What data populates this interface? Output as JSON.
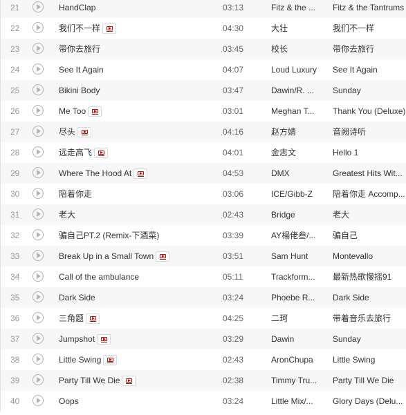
{
  "colors": {
    "row_alt": "#f7f7f7",
    "mv_icon": "#c20c0c",
    "play_icon": "#b3b3b3"
  },
  "tracks": [
    {
      "no": "21",
      "title": "HandClap",
      "mv": false,
      "duration": "03:13",
      "artist": "Fitz & the ...",
      "album": "Fitz & the Tantrums"
    },
    {
      "no": "22",
      "title": "我们不一样",
      "mv": true,
      "duration": "04:30",
      "artist": "大壮",
      "album": "我们不一样"
    },
    {
      "no": "23",
      "title": "带你去旅行",
      "mv": false,
      "duration": "03:45",
      "artist": "校长",
      "album": "带你去旅行"
    },
    {
      "no": "24",
      "title": "See It Again",
      "mv": false,
      "duration": "04:07",
      "artist": "Loud Luxury",
      "album": "See It Again"
    },
    {
      "no": "25",
      "title": "Bikini Body",
      "mv": false,
      "duration": "03:47",
      "artist": "Dawin/R. ...",
      "album": "Sunday"
    },
    {
      "no": "26",
      "title": "Me Too",
      "mv": true,
      "duration": "03:01",
      "artist": "Meghan T...",
      "album": "Thank You (Deluxe)"
    },
    {
      "no": "27",
      "title": "尽头",
      "mv": true,
      "duration": "04:16",
      "artist": "赵方婧",
      "album": "音阙诗听"
    },
    {
      "no": "28",
      "title": "远走高飞",
      "mv": true,
      "duration": "04:01",
      "artist": "金志文",
      "album": "Hello 1"
    },
    {
      "no": "29",
      "title": "Where The Hood At",
      "mv": true,
      "duration": "04:53",
      "artist": "DMX",
      "album": "Greatest Hits Wit..."
    },
    {
      "no": "30",
      "title": "陪着你走",
      "mv": false,
      "duration": "03:06",
      "artist": "ICE/Gibb-Z",
      "album": "陪着你走 Accomp..."
    },
    {
      "no": "31",
      "title": "老大",
      "mv": false,
      "duration": "02:43",
      "artist": "Bridge",
      "album": "老大"
    },
    {
      "no": "32",
      "title": "骗自己PT.2 (Remix-下酒菜)",
      "mv": false,
      "duration": "03:39",
      "artist": "AY楊佬叁/...",
      "album": "骗自己"
    },
    {
      "no": "33",
      "title": "Break Up in a Small Town",
      "mv": true,
      "duration": "03:51",
      "artist": "Sam Hunt",
      "album": "Montevallo"
    },
    {
      "no": "34",
      "title": "Call of the ambulance",
      "mv": false,
      "duration": "05:11",
      "artist": "Trackform...",
      "album": "最新热歌慢摇91"
    },
    {
      "no": "35",
      "title": "Dark Side",
      "mv": false,
      "duration": "03:24",
      "artist": "Phoebe R...",
      "album": "Dark Side"
    },
    {
      "no": "36",
      "title": "三角题",
      "mv": true,
      "duration": "04:25",
      "artist": "二珂",
      "album": "带着音乐去旅行"
    },
    {
      "no": "37",
      "title": "Jumpshot",
      "mv": true,
      "duration": "03:29",
      "artist": "Dawin",
      "album": "Sunday"
    },
    {
      "no": "38",
      "title": "Little Swing",
      "mv": true,
      "duration": "02:43",
      "artist": "AronChupa",
      "album": "Little Swing"
    },
    {
      "no": "39",
      "title": "Party Till We Die",
      "mv": true,
      "duration": "02:38",
      "artist": "Timmy Tru...",
      "album": "Party Till We Die"
    },
    {
      "no": "40",
      "title": "Oops",
      "mv": false,
      "duration": "03:24",
      "artist": "Little Mix/...",
      "album": "Glory Days (Delu..."
    }
  ]
}
